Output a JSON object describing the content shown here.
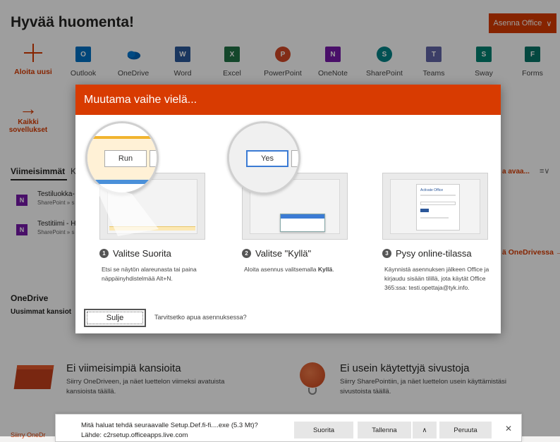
{
  "header": {
    "greeting": "Hyvää huomenta!",
    "install_label": "Asenna Office",
    "install_icon": "chevron-down-icon"
  },
  "apps": [
    {
      "label": "Aloita uusi",
      "icon": "plus-icon",
      "color": "#d83b01"
    },
    {
      "label": "Outlook",
      "letter": "O",
      "color": "#0072c6"
    },
    {
      "label": "OneDrive",
      "letter": "",
      "color": "#0364b8"
    },
    {
      "label": "Word",
      "letter": "W",
      "color": "#2b579a"
    },
    {
      "label": "Excel",
      "letter": "X",
      "color": "#217346"
    },
    {
      "label": "PowerPoint",
      "letter": "P",
      "color": "#d24726"
    },
    {
      "label": "OneNote",
      "letter": "N",
      "color": "#7719aa"
    },
    {
      "label": "SharePoint",
      "letter": "S",
      "color": "#038387"
    },
    {
      "label": "Teams",
      "letter": "T",
      "color": "#6264a7"
    },
    {
      "label": "Sway",
      "letter": "S",
      "color": "#008272"
    },
    {
      "label": "Forms",
      "letter": "F",
      "color": "#077568"
    }
  ],
  "all_apps": {
    "arrow": "→",
    "line1": "Kaikki",
    "line2": "sovellukset"
  },
  "recent": {
    "tab_active": "Viimeisimmät",
    "tab_other": "K",
    "rows": [
      {
        "title": "Testiluokka-",
        "sub": "SharePoint » s",
        "icon": "N"
      },
      {
        "title": "Testitiimi - H",
        "sub": "SharePoint » s",
        "icon": "N"
      }
    ],
    "open_link": "a avaa...",
    "sort_icon": "≡∨",
    "onedrive_link": "ä OneDrivessa →"
  },
  "onedrive": {
    "title": "OneDrive",
    "subtitle": "Uusimmat kansiot"
  },
  "empty_folders": {
    "title": "Ei viimeisimpiä kansioita",
    "desc": "Siirry OneDriveen, ja näet luettelon viimeksi avatuista kansioista täällä."
  },
  "empty_sites": {
    "title": "Ei usein käytettyjä sivustoja",
    "desc": "Siirry SharePointiin, ja näet luettelon usein käyttämistäsi sivustoista täällä."
  },
  "bottom_left": "Siirry OneDr",
  "modal": {
    "title": "Muutama vaihe vielä...",
    "steps": [
      {
        "num": "1",
        "title": "Valitse Suorita",
        "desc": "Etsi se näytön alareunasta tai paina näppäinyhdistelmää Alt+N.",
        "mock_button": "Run"
      },
      {
        "num": "2",
        "title": "Valitse \"Kyllä\"",
        "desc_pre": "Aloita asennus valitsemalla ",
        "desc_bold": "Kyllä",
        "desc_post": ".",
        "mock_button": "Yes"
      },
      {
        "num": "3",
        "title": "Pysy online-tilassa",
        "desc": "Käynnistä asennuksen jälkeen Office ja kirjaudu sisään tilillä, jota käytät Office 365:ssa: testi.opettaja@tyk.info.",
        "mock_heading": "Activate Office"
      }
    ],
    "close_label": "Sulje",
    "help_text": "Tarvitsetko apua asennuksessa?"
  },
  "download_bar": {
    "question": "Mitä haluat tehdä seuraavalle Setup.Def.fi-fi....exe (5.3 Mt)?",
    "source": "Lähde: c2rsetup.officeapps.live.com",
    "run_label": "Suorita",
    "save_label": "Tallenna",
    "expand_icon": "∧",
    "cancel_label": "Peruuta",
    "close_icon": "✕"
  }
}
